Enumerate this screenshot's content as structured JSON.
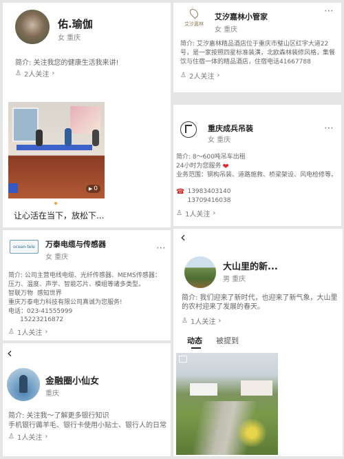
{
  "p1": {
    "name": "佑.瑜伽",
    "gender_city": "女 重庆",
    "bio": "简介: 关注我您的健康生活我来讲!",
    "followers": "2人关注",
    "video_views": "0",
    "caption": "让心活在当下，放松下..."
  },
  "p2": {
    "logo_small": "艾汐嘉林",
    "name": "艾汐嘉林小管家",
    "gender_city": "女 重庆",
    "bio": "简介: 艾汐嘉林精品酒店位于重庆市璧山区红宇大道22号，是一家按照四星标准装潢，北欧森林装修风格，集餐饮与住宿一体的精品酒店，住宿电话41667788",
    "followers": "2人关注"
  },
  "p3": {
    "name": "重庆成兵吊装",
    "gender_city": "女 重庆",
    "bio1": "简介: 8～600吨吊车出租",
    "bio2": "24小时为您服务",
    "bio3": "业务范围：钢构吊装、道路施救、桥梁架设、风电检修等。",
    "phone1": "13983403140",
    "phone2": "13709416038",
    "followers": "1人关注"
  },
  "p4": {
    "logo_text": "ocean-tele",
    "name": "万泰电缆与传感器",
    "gender_city": "女 重庆",
    "bio": [
      "简介: 公司主营电线电缆、光纤传感器、MEMS传感器：",
      "压力、温度、声学、智能芯片、模组等诸多类型。",
      "智联万物  感知世界",
      "重庆万泰电力科技有限公司真诚为您服务!",
      "电话：023-41555999",
      "      15223216872"
    ],
    "followers": "1人关注"
  },
  "p5": {
    "name": "大山里的新...",
    "gender_city": "男 重庆",
    "bio": "简介: 我们迎来了新时代，也迎来了新气象，大山里的农村迎来了发展的春天。",
    "followers": "1人关注",
    "tabs": [
      "动态",
      "被提到"
    ]
  },
  "p6": {
    "name": "金融圈小仙女",
    "city": "重庆",
    "bio1": "简介: 关注我～了解更多银行知识",
    "bio2": "手机银行薅羊毛、银行卡使用小贴士、银行人的日常",
    "followers": "1人关注"
  },
  "icons": {
    "more": "⋯",
    "back": "‹",
    "chevron": "›",
    "play": "▶",
    "person": "♙",
    "phone": "☎",
    "heart": "❤"
  }
}
